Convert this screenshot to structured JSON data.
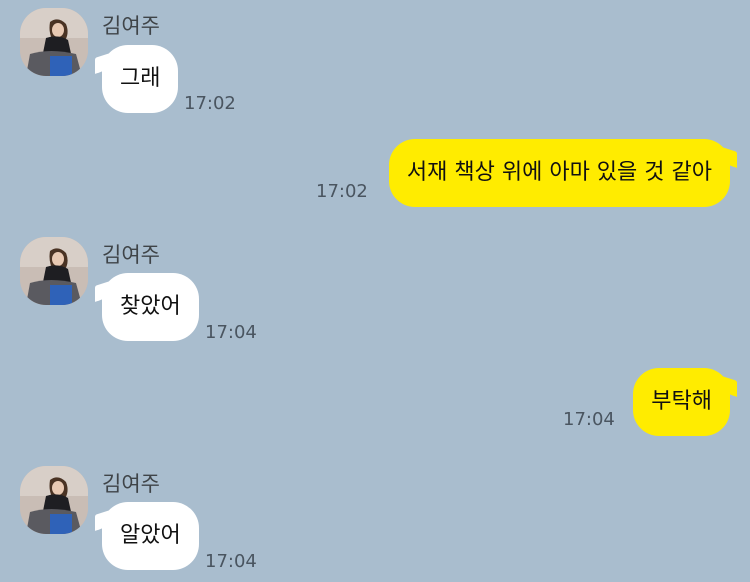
{
  "chat": {
    "messages": [
      {
        "from": "other",
        "sender": "김여주",
        "avatar_icon": "profile-photo",
        "text": "그래",
        "time": "17:02"
      },
      {
        "from": "me",
        "text": "서재 책상 위에 아마 있을 것 같아",
        "time": "17:02"
      },
      {
        "from": "other",
        "sender": "김여주",
        "avatar_icon": "profile-photo",
        "text": "찾았어",
        "time": "17:04"
      },
      {
        "from": "me",
        "text": "부탁해",
        "time": "17:04"
      },
      {
        "from": "other",
        "sender": "김여주",
        "avatar_icon": "profile-photo",
        "text": "알았어",
        "time": "17:04"
      }
    ]
  },
  "colors": {
    "background": "#a9bdce",
    "incoming_bubble": "#ffffff",
    "outgoing_bubble": "#ffec00"
  }
}
